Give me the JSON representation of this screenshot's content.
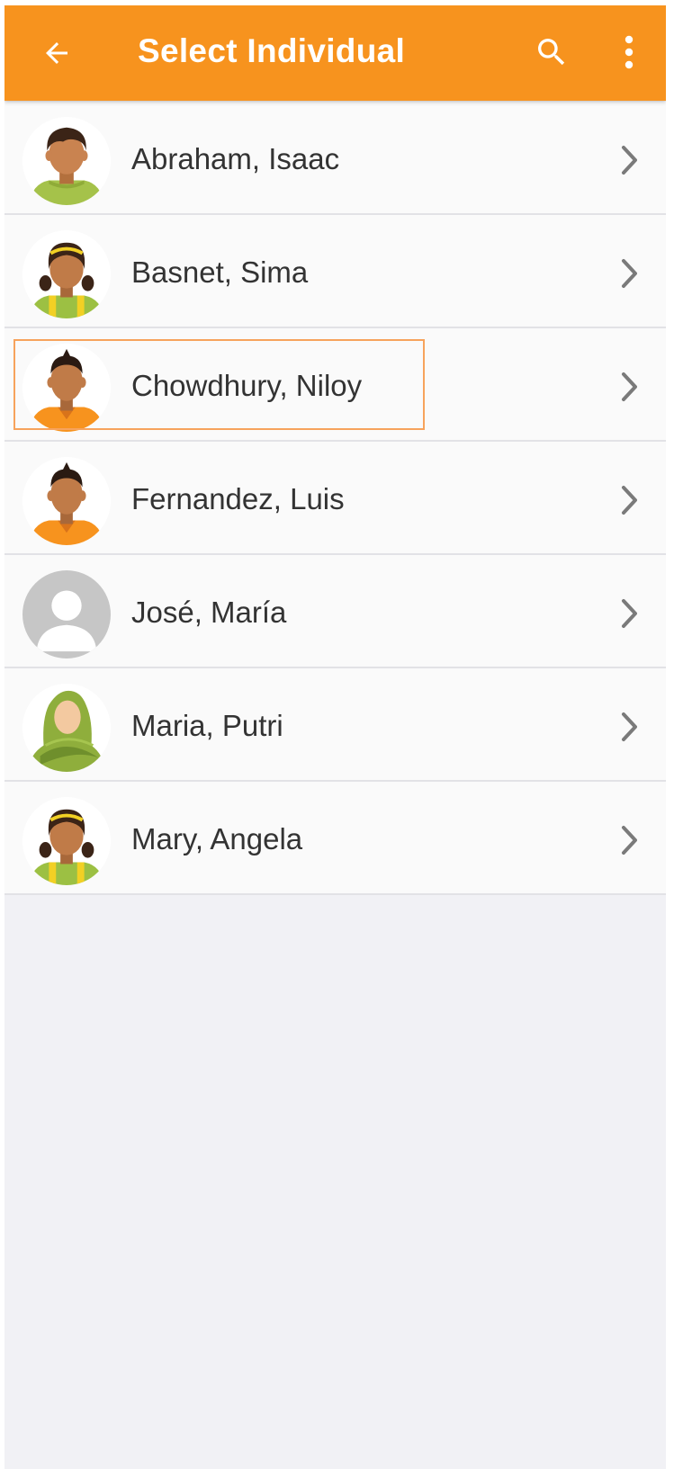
{
  "appbar": {
    "title": "Select Individual",
    "back_icon": "arrow-left-icon",
    "search_icon": "search-icon",
    "more_icon": "more-vertical-icon",
    "color": "#f7931e"
  },
  "individuals": [
    {
      "name": "Abraham, Isaac",
      "avatar": "boy-green-avatar"
    },
    {
      "name": "Basnet, Sima",
      "avatar": "girl-yellow-avatar"
    },
    {
      "name": "Chowdhury, Niloy",
      "avatar": "boy-orange-avatar",
      "selected": true
    },
    {
      "name": "Fernandez, Luis",
      "avatar": "boy-orange-avatar"
    },
    {
      "name": "José, María",
      "avatar": "default-avatar"
    },
    {
      "name": "Maria, Putri",
      "avatar": "hijab-avatar"
    },
    {
      "name": "Mary, Angela",
      "avatar": "girl-yellow-avatar"
    }
  ],
  "row_chevron_icon": "chevron-right-icon",
  "selection_color": "#f7a35c"
}
